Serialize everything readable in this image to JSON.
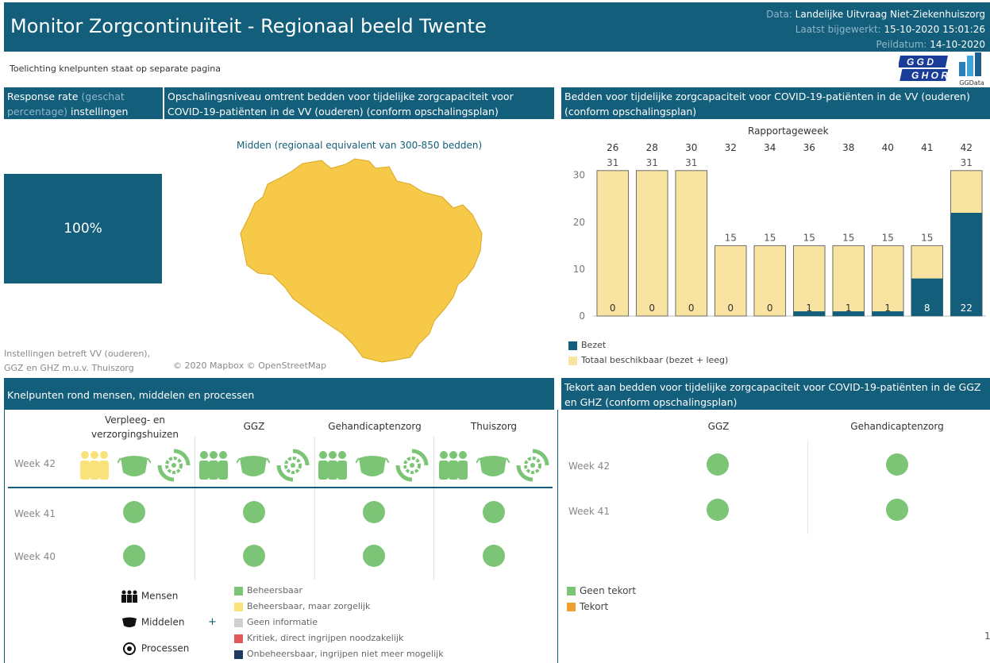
{
  "header": {
    "title": "Monitor Zorgcontinuïteit - Regionaal beeld Twente",
    "data_line_label": "Data:",
    "data_line_value": "Landelijke Uitvraag Niet-Ziekenhuiszorg",
    "updated_label": "Laatst bijgewerkt:",
    "updated_value": "15-10-2020 15:01:26",
    "peildatum_label": "Peildatum:",
    "peildatum_value": "14-10-2020"
  },
  "subheader": {
    "note": "Toelichting knelpunten staat op separate pagina",
    "logo_ggd": "GGD GHOR",
    "logo_ggdata": "GGData"
  },
  "response": {
    "title_part1": "Response rate",
    "title_part2": "(geschat percentage)",
    "title_part3": "instellingen",
    "value": "100%",
    "footnote_line1": "Instellingen betreft VV (ouderen),",
    "footnote_line2": "GGZ en GHZ m.u.v. Thuiszorg"
  },
  "map": {
    "title": "Opschalingsniveau omtrent bedden voor tijdelijke zorgcapaciteit voor COVID-19-patiënten in de VV (ouderen) (conform opschalingsplan)",
    "level": "Midden (regionaal equivalent van 300-850 bedden)",
    "credit": "© 2020 Mapbox © OpenStreetMap",
    "fill_color": "#f7c948"
  },
  "chart_data": {
    "type": "bar",
    "title": "Bedden voor tijdelijke zorgcapaciteit voor COVID-19-patiënten in de VV (ouderen) (conform opschalingsplan)",
    "xlabel": "Rapportageweek",
    "categories": [
      "26",
      "28",
      "30",
      "32",
      "34",
      "36",
      "38",
      "40",
      "41",
      "42"
    ],
    "series": [
      {
        "name": "Totaal beschikbaar (bezet + leeg)",
        "values": [
          31,
          31,
          31,
          15,
          15,
          15,
          15,
          15,
          15,
          31
        ],
        "color": "#f9e3a1"
      },
      {
        "name": "Bezet",
        "values": [
          0,
          0,
          0,
          0,
          0,
          1,
          1,
          1,
          8,
          22
        ],
        "color": "#135e7a"
      }
    ],
    "yticks": [
      0,
      10,
      20,
      30
    ],
    "ylim": [
      0,
      33
    ],
    "legend": "bottom-left"
  },
  "knelpunten": {
    "title": "Knelpunten rond mensen, middelen en processen",
    "columns": [
      "Verpleeg- en verzorgingshuizen",
      "GGZ",
      "Gehandicaptenzorg",
      "Thuiszorg"
    ],
    "rows": [
      {
        "week": "Week 42",
        "mensen": [
          "#f9e27a",
          "#7cc576",
          "#7cc576",
          "#7cc576"
        ]
      },
      {
        "week": "Week 41",
        "status": [
          "#7cc576",
          "#7cc576",
          "#7cc576",
          "#7cc576"
        ]
      },
      {
        "week": "Week 40",
        "status": [
          "#7cc576",
          "#7cc576",
          "#7cc576",
          "#7cc576"
        ]
      }
    ],
    "icon_legend": [
      "Mensen",
      "Middelen",
      "Processen"
    ],
    "plus": "+",
    "status_legend": [
      {
        "label": "Beheersbaar",
        "color": "#7cc576"
      },
      {
        "label": "Beheersbaar, maar zorgelijk",
        "color": "#f9e27a"
      },
      {
        "label": "Geen informatie",
        "color": "#d0d0d0"
      },
      {
        "label": "Kritiek, direct ingrijpen noodzakelijk",
        "color": "#e05a5a"
      },
      {
        "label": "Onbeheersbaar, ingrijpen niet meer mogelijk",
        "color": "#1f3a5f"
      }
    ]
  },
  "tekort": {
    "title": "Tekort aan bedden voor tijdelijke zorgcapaciteit voor COVID-19-patiënten in de GGZ en GHZ (conform opschalingsplan)",
    "columns": [
      "GGZ",
      "Gehandicaptenzorg"
    ],
    "rows": [
      {
        "week": "Week 42"
      },
      {
        "week": "Week 41"
      }
    ],
    "legend": [
      {
        "label": "Geen tekort",
        "color": "#7cc576"
      },
      {
        "label": "Tekort",
        "color": "#f0a030"
      }
    ],
    "page_num": "1"
  }
}
